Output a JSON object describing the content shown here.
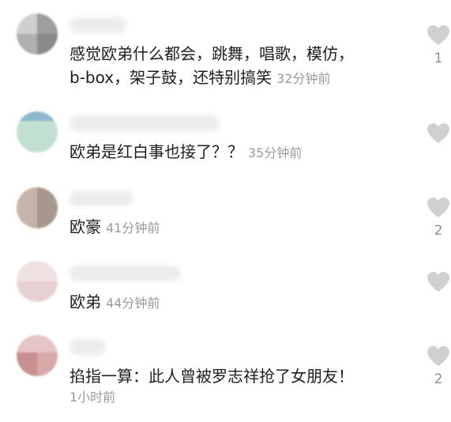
{
  "comments": [
    {
      "text_lines": [
        "感觉欧弟什么都会，跳舞，唱歌，模仿，",
        "b-box，架子鼓，还特别搞笑"
      ],
      "time": "32分钟前",
      "likes": "1"
    },
    {
      "text_lines": [
        "欧弟是红白事也接了？？"
      ],
      "time": "35分钟前",
      "likes": ""
    },
    {
      "text_lines": [
        "欧豪"
      ],
      "time": "41分钟前",
      "likes": "2"
    },
    {
      "text_lines": [
        "欧弟"
      ],
      "time": "44分钟前",
      "likes": ""
    },
    {
      "text_lines": [
        "掐指一算：此人曾被罗志祥抢了女朋友！"
      ],
      "time": "1小时前",
      "likes": "2"
    }
  ],
  "icons": {
    "like": "heart-icon"
  },
  "colors": {
    "text": "#1e1e1e",
    "meta": "#9a9a9a",
    "heart": "#d0d0d0"
  }
}
